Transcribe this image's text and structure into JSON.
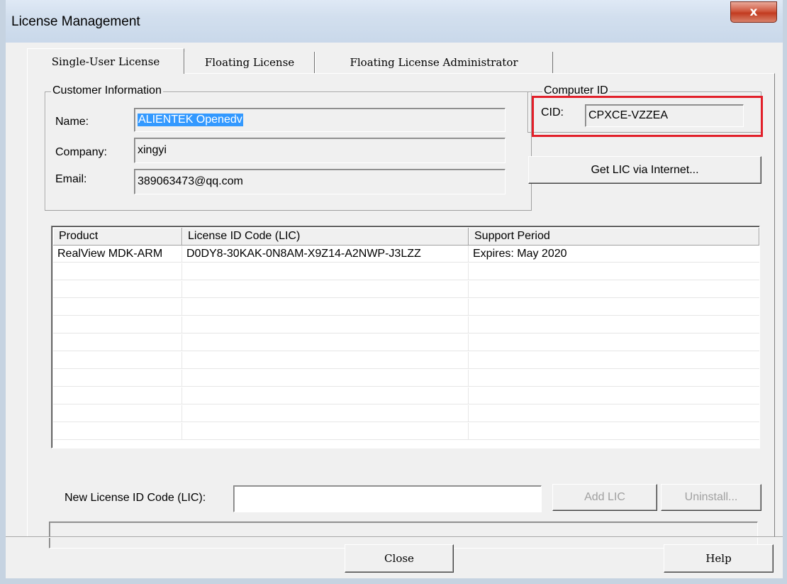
{
  "window": {
    "title": "License Management",
    "close_glyph": "x"
  },
  "tabs": [
    {
      "label": "Single-User License",
      "active": true
    },
    {
      "label": "Floating License",
      "active": false
    },
    {
      "label": "Floating License Administrator",
      "active": false
    }
  ],
  "customer": {
    "legend": "Customer Information",
    "name_label": "Name:",
    "name_value": "ALIENTEK Openedv",
    "company_label": "Company:",
    "company_value": "xingyi",
    "email_label": "Email:",
    "email_value": "389063473@qq.com"
  },
  "computer": {
    "legend": "Computer ID",
    "cid_label": "CID:",
    "cid_value": "CPXCE-VZZEA",
    "highlight_color": "#e2202a"
  },
  "get_lic_button": "Get LIC via Internet...",
  "license_table": {
    "columns": [
      "Product",
      "License ID Code (LIC)",
      "Support Period"
    ],
    "rows": [
      [
        "RealView MDK-ARM",
        "D0DY8-30KAK-0N8AM-X9Z14-A2NWP-J3LZZ",
        "Expires: May 2020"
      ]
    ]
  },
  "new_lic": {
    "label": "New License ID Code (LIC):",
    "value": ""
  },
  "add_lic_button": "Add LIC",
  "uninstall_button": "Uninstall...",
  "status_text": "",
  "footer": {
    "close_button": "Close",
    "help_button": "Help"
  },
  "colors": {
    "selection": "#3399ff",
    "dialog_bg": "#f0f0f0"
  }
}
